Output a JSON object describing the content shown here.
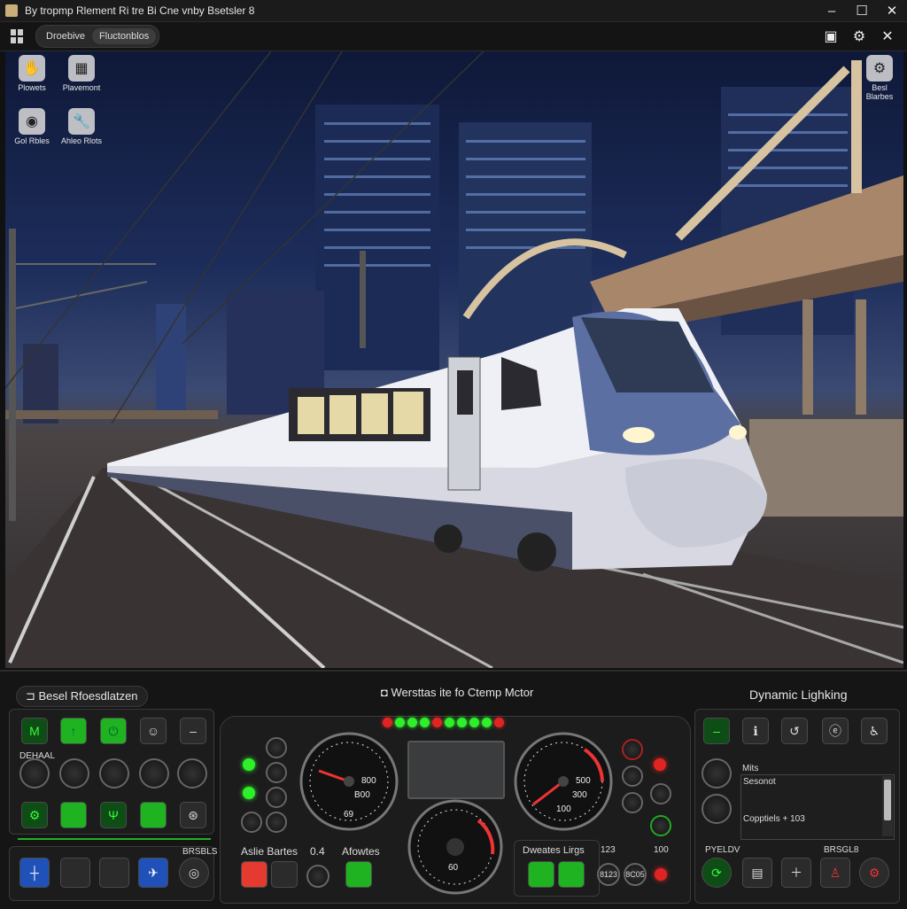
{
  "window": {
    "title": "By tropmp Rlement Ri tre Bi Cne vnby Bsetsler 8",
    "minimize": "–",
    "maximize": "☐",
    "close": "✕"
  },
  "toolbar": {
    "tab1": "Droebive",
    "tab2": "Fluctonblos"
  },
  "desktop_icons": [
    {
      "label": "Plowets",
      "glyph": "✋"
    },
    {
      "label": "Plavemont",
      "glyph": "▦"
    },
    {
      "label": "Gol Rbles",
      "glyph": "◉"
    },
    {
      "label": "Ahleo Rlots",
      "glyph": "🔧"
    },
    {
      "label": "Besl Blarbes",
      "glyph": "⚙"
    }
  ],
  "left_panel": {
    "title": "Besel Rfoesdlatzen",
    "knob_label": "DEHAAL",
    "bottom_label": "BRSBLS"
  },
  "center_panel": {
    "title": "Wersttas ite fo Ctemp Mctor",
    "bottom_left_label": "Aslie Bartes",
    "bottom_left_value": "0.4",
    "bottom_mid_label": "Afowtes",
    "bottom_right_label": "Dweates Lirgs",
    "digit1": "123",
    "digit2": "100",
    "mini1": "8123",
    "mini2": "8C05",
    "gauge_left_top": "800",
    "gauge_left_mid": "B00",
    "gauge_left_bottom": "69",
    "gauge_right_top": "500",
    "gauge_right_mid": "300",
    "gauge_right_bottom": "100",
    "gauge_bottom_value": "60",
    "led_strip": [
      "r",
      "g",
      "g",
      "g",
      "r",
      "g",
      "g",
      "g",
      "g",
      "r"
    ]
  },
  "right_panel": {
    "title": "Dynamic Lighking",
    "list_lines": [
      "Mits",
      "Sesonot",
      "Copptiels + 103"
    ],
    "label_left": "PYELDV",
    "label_right": "BRSGL8"
  }
}
